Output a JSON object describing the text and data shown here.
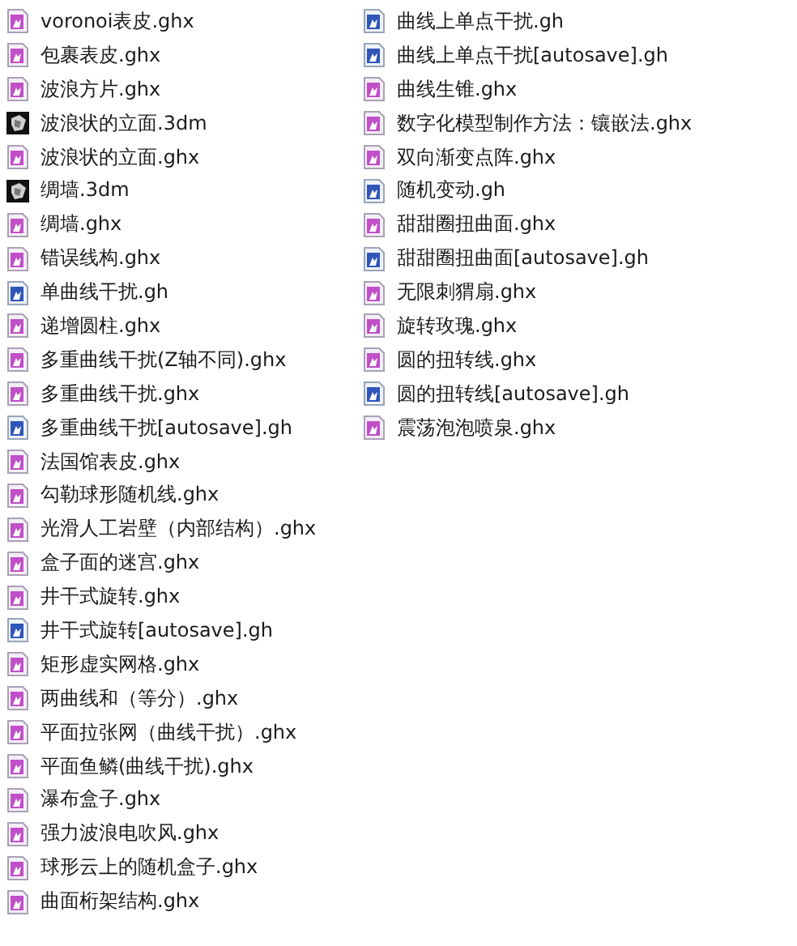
{
  "columns": [
    {
      "files": [
        {
          "name": "voronoi表皮.ghx",
          "kind": "ghx"
        },
        {
          "name": "包裹表皮.ghx",
          "kind": "ghx"
        },
        {
          "name": "波浪方片.ghx",
          "kind": "ghx"
        },
        {
          "name": "波浪状的立面.3dm",
          "kind": "model"
        },
        {
          "name": "波浪状的立面.ghx",
          "kind": "ghx"
        },
        {
          "name": "绸墙.3dm",
          "kind": "model"
        },
        {
          "name": "绸墙.ghx",
          "kind": "ghx"
        },
        {
          "name": "错误线构.ghx",
          "kind": "ghx"
        },
        {
          "name": "单曲线干扰.gh",
          "kind": "gh"
        },
        {
          "name": "递增圆柱.ghx",
          "kind": "ghx"
        },
        {
          "name": "多重曲线干扰(Z轴不同).ghx",
          "kind": "ghx"
        },
        {
          "name": "多重曲线干扰.ghx",
          "kind": "ghx"
        },
        {
          "name": "多重曲线干扰[autosave].gh",
          "kind": "gh"
        },
        {
          "name": "法国馆表皮.ghx",
          "kind": "ghx"
        },
        {
          "name": "勾勒球形随机线.ghx",
          "kind": "ghx"
        },
        {
          "name": "光滑人工岩壁（内部结构）.ghx",
          "kind": "ghx"
        },
        {
          "name": "盒子面的迷宫.ghx",
          "kind": "ghx"
        },
        {
          "name": "井干式旋转.ghx",
          "kind": "ghx"
        },
        {
          "name": "井干式旋转[autosave].gh",
          "kind": "gh"
        },
        {
          "name": "矩形虚实网格.ghx",
          "kind": "ghx"
        },
        {
          "name": "两曲线和（等分）.ghx",
          "kind": "ghx"
        },
        {
          "name": "平面拉张网（曲线干扰）.ghx",
          "kind": "ghx"
        },
        {
          "name": "平面鱼鳞(曲线干扰).ghx",
          "kind": "ghx"
        },
        {
          "name": "瀑布盒子.ghx",
          "kind": "ghx"
        },
        {
          "name": "强力波浪电吹风.ghx",
          "kind": "ghx"
        },
        {
          "name": "球形云上的随机盒子.ghx",
          "kind": "ghx"
        },
        {
          "name": "曲面桁架结构.ghx",
          "kind": "ghx"
        }
      ]
    },
    {
      "files": [
        {
          "name": "曲线上单点干扰.gh",
          "kind": "gh"
        },
        {
          "name": "曲线上单点干扰[autosave].gh",
          "kind": "gh"
        },
        {
          "name": "曲线生锥.ghx",
          "kind": "ghx"
        },
        {
          "name": "数字化模型制作方法：镶嵌法.ghx",
          "kind": "ghx"
        },
        {
          "name": "双向渐变点阵.ghx",
          "kind": "ghx"
        },
        {
          "name": "随机变动.gh",
          "kind": "gh"
        },
        {
          "name": "甜甜圈扭曲面.ghx",
          "kind": "ghx"
        },
        {
          "name": "甜甜圈扭曲面[autosave].gh",
          "kind": "gh"
        },
        {
          "name": "无限刺猬扇.ghx",
          "kind": "ghx"
        },
        {
          "name": "旋转玫瑰.ghx",
          "kind": "ghx"
        },
        {
          "name": "圆的扭转线.ghx",
          "kind": "ghx"
        },
        {
          "name": "圆的扭转线[autosave].gh",
          "kind": "gh"
        },
        {
          "name": "震荡泡泡喷泉.ghx",
          "kind": "ghx"
        }
      ]
    }
  ]
}
